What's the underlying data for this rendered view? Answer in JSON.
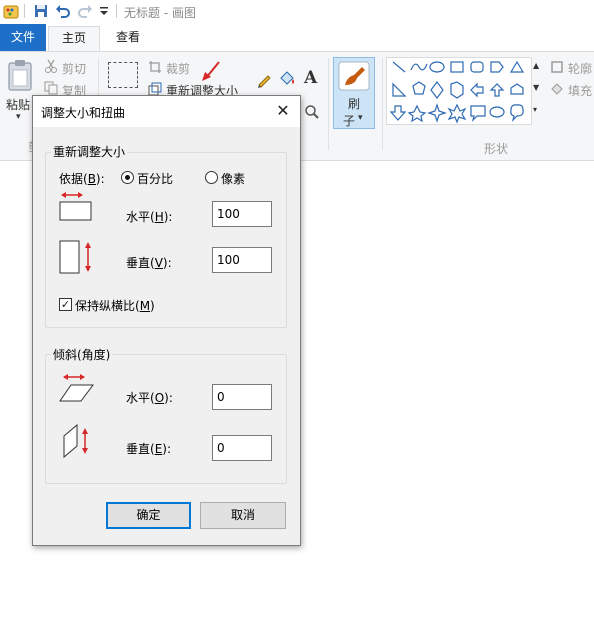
{
  "titlebar": {
    "title": "无标题 - 画图"
  },
  "tabs": {
    "file": "文件",
    "home": "主页",
    "view": "查看"
  },
  "ribbon": {
    "clipboard": {
      "paste": "粘贴",
      "cut": "剪切",
      "copy": "复制",
      "group_label_fragment": "剪"
    },
    "image": {
      "crop": "裁剪",
      "resize": "重新调整大小"
    },
    "brushes": {
      "label_line1": "刷",
      "label_line2": "子"
    },
    "shapes": {
      "group_label": "形状",
      "outline": "轮廓",
      "fill": "填充"
    }
  },
  "dialog": {
    "title": "调整大小和扭曲",
    "resize_group": {
      "label": "重新调整大小",
      "by_label": "依据(",
      "by_key": "B",
      "by_suffix": "):",
      "percent": "百分比",
      "pixels": "像素",
      "horizontal_label": "水平(",
      "horizontal_key": "H",
      "horizontal_suffix": "):",
      "horizontal_value": "100",
      "vertical_label": "垂直(",
      "vertical_key": "V",
      "vertical_suffix": "):",
      "vertical_value": "100",
      "keep_ratio_label": "保持纵横比(",
      "keep_ratio_key": "M",
      "keep_ratio_suffix": ")",
      "keep_ratio_checked": true,
      "selected_mode": "百分比"
    },
    "skew_group": {
      "label": "倾斜(角度)",
      "horizontal_label": "水平(",
      "horizontal_key": "O",
      "horizontal_suffix": "):",
      "horizontal_value": "0",
      "vertical_label": "垂直(",
      "vertical_key": "E",
      "vertical_suffix": "):",
      "vertical_value": "0"
    },
    "ok": "确定",
    "cancel": "取消"
  },
  "colors": {
    "file_tab": "#1e6fc7",
    "accent_arrow": "#d62828",
    "default_button_border": "#0078d7"
  }
}
